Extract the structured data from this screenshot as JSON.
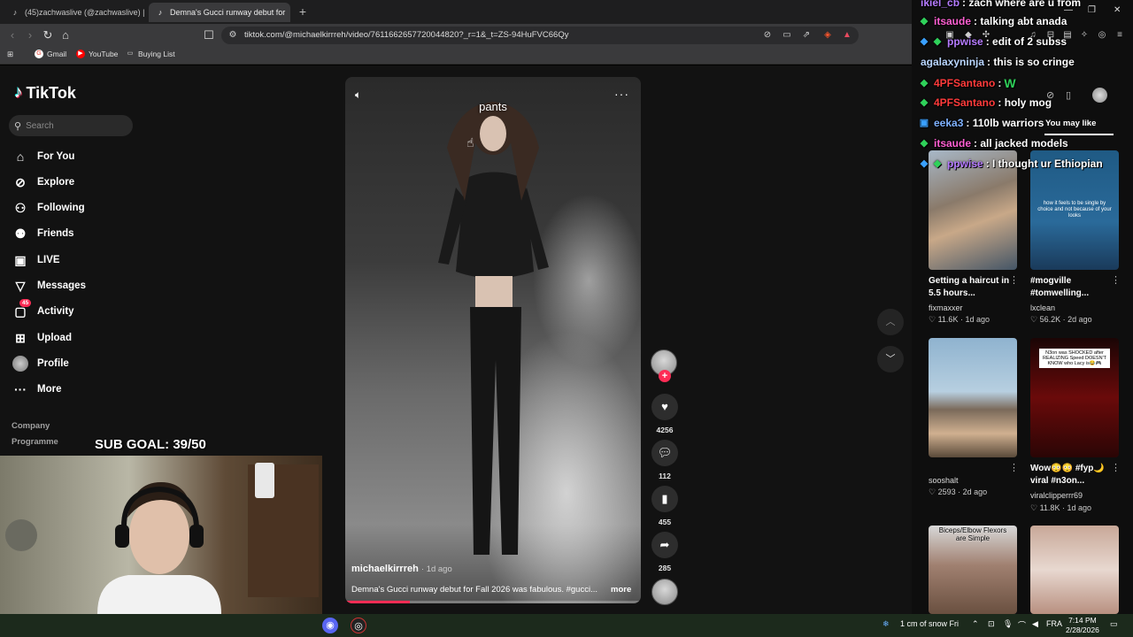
{
  "browser": {
    "tabs": [
      {
        "title": "(45)zachwaslive (@zachwaslive) | TikT",
        "active": false
      },
      {
        "title": "Demna's Gucci runway debut for",
        "active": true
      }
    ],
    "new_tab": "+",
    "url": "tiktok.com/@michaelkirrreh/video/7611662657720044820?_r=1&_t=ZS-94HuFVC66Qy",
    "bookmarks": [
      "Gmail",
      "YouTube",
      "Buying List"
    ]
  },
  "tiktok": {
    "logo": "TikTok",
    "search_placeholder": "Search",
    "nav": [
      {
        "label": "For You",
        "icon": "home-icon"
      },
      {
        "label": "Explore",
        "icon": "compass-icon"
      },
      {
        "label": "Following",
        "icon": "following-icon"
      },
      {
        "label": "Friends",
        "icon": "friends-icon"
      },
      {
        "label": "LIVE",
        "icon": "live-icon"
      },
      {
        "label": "Messages",
        "icon": "messages-icon"
      },
      {
        "label": "Activity",
        "icon": "activity-icon",
        "badge": "45"
      },
      {
        "label": "Upload",
        "icon": "upload-icon"
      },
      {
        "label": "Profile",
        "icon": "profile-avatar"
      },
      {
        "label": "More",
        "icon": "more-icon"
      }
    ],
    "footer": [
      "Company",
      "Programme"
    ],
    "video": {
      "top_caption": "pants",
      "author": "michaelkirrreh",
      "time": "· 1d ago",
      "description": "Demna's Gucci runway debut for Fall 2026 was fabulous. #gucci...",
      "more": "more",
      "progress": 0.22
    },
    "actions": {
      "likes": "4256",
      "comments": "112",
      "saves": "455",
      "shares": "285"
    },
    "you_may_like": "You may like",
    "suggestions": [
      {
        "title": "Getting a haircut in 5.5 hours...",
        "user": "fixmaxxer",
        "likes": "11.6K",
        "age": "1d ago",
        "thumb_text": ""
      },
      {
        "title": "#mogville #tomwelling...",
        "user": "lxclean",
        "likes": "56.2K",
        "age": "2d ago",
        "thumb_text": "how it feels to be single by choice and not because of your looks"
      },
      {
        "title": "",
        "user": "sooshalt",
        "likes": "2593",
        "age": "2d ago",
        "thumb_text": ""
      },
      {
        "title": "Wow😳😳 #fyp🌙 viral #n3on...",
        "user": "viralclipperrr69",
        "likes": "11.8K",
        "age": "1d ago",
        "thumb_text": "N3on was SHOCKED after REALIZING Speed DOESN'T KNOW who Lacy is😂🎮"
      },
      {
        "thumb_text": "Biceps/Elbow Flexors are Simple"
      },
      {
        "thumb_text": ""
      }
    ]
  },
  "chat": [
    {
      "user": "ikiel_cb",
      "msg": " : zach where are u from",
      "color": "#b57bff",
      "badges": []
    },
    {
      "user": "itsaude",
      "msg": " : talking abt anada",
      "color": "#ff5fd2",
      "badges": [
        "green"
      ]
    },
    {
      "user": "ppwise",
      "msg": " : edit of 2 subss",
      "color": "#b57bff",
      "badges": [
        "blue",
        "green"
      ]
    },
    {
      "user": "agalaxyninja",
      "msg": " : this is so cringe",
      "color": "#b9d6ff",
      "badges": []
    },
    {
      "user": "4PFSantano",
      "msg": " : ",
      "color": "#ff3b3b",
      "badges": [
        "green"
      ],
      "emote": "W"
    },
    {
      "user": "4PFSantano",
      "msg": " : holy mog",
      "color": "#ff3b3b",
      "badges": [
        "green"
      ]
    },
    {
      "user": "eeka3",
      "msg": " : 110lb warriors",
      "color": "#7fb2ff",
      "badges": [
        "blue"
      ]
    },
    {
      "user": "itsaude",
      "msg": " : all jacked models",
      "color": "#ff5fd2",
      "badges": [
        "green"
      ]
    },
    {
      "user": "ppwise",
      "msg": " : I thought ur Ethiopian",
      "color": "#b57bff",
      "badges": [
        "blue",
        "green"
      ]
    }
  ],
  "stream": {
    "sub_goal": "SUB GOAL: 39/50"
  },
  "taskbar": {
    "weather": "1 cm of snow Fri",
    "lang": "FRA",
    "time": "7:14 PM",
    "date": "2/28/2026"
  },
  "colors": {
    "tiktok_red": "#fe2c55",
    "tiktok_cyan": "#25f4ee",
    "page_bg": "#121212"
  }
}
